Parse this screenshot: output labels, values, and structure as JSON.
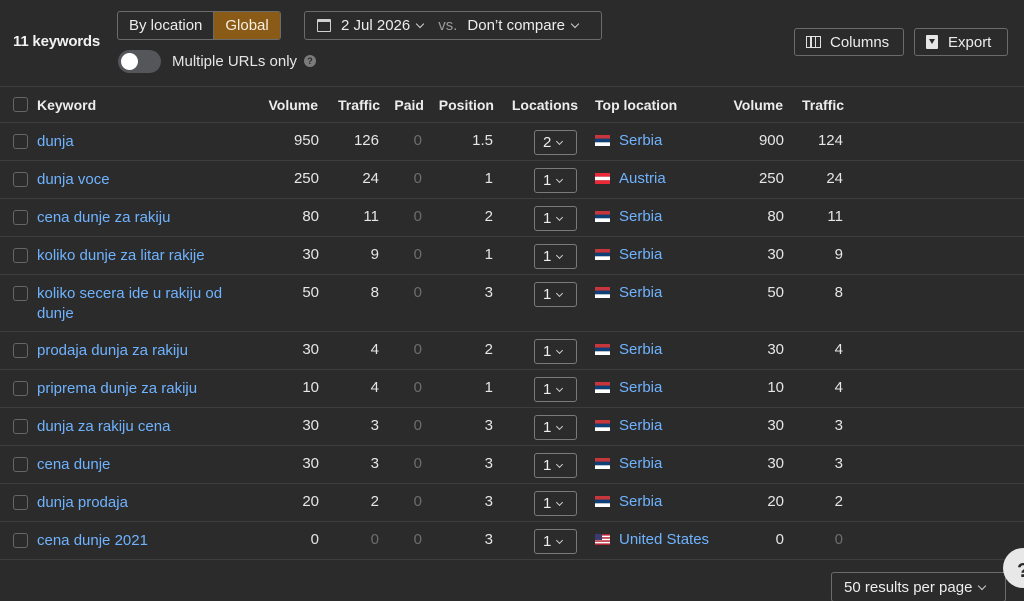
{
  "toolbar": {
    "keyword_count": "11 keywords",
    "scope_tabs": [
      "By location",
      "Global"
    ],
    "active_scope": "Global",
    "multiple_urls_label": "Multiple URLs only",
    "multiple_urls_on": false,
    "date": "2 Jul 2026",
    "vs_label": "vs.",
    "compare": "Don’t compare",
    "columns_label": "Columns",
    "export_label": "Export"
  },
  "table": {
    "headers": {
      "keyword": "Keyword",
      "volume": "Volume",
      "traffic": "Traffic",
      "paid": "Paid",
      "position": "Position",
      "locations": "Locations",
      "top_location": "Top location",
      "tl_volume": "Volume",
      "tl_traffic": "Traffic"
    },
    "rows": [
      {
        "keyword": "dunja",
        "volume": "950",
        "traffic": "126",
        "paid": "0",
        "position": "1.5",
        "locations": "2",
        "country": "Serbia",
        "flag": "serbia-flag-icon",
        "tl_volume": "900",
        "tl_traffic": "124"
      },
      {
        "keyword": "dunja voce",
        "volume": "250",
        "traffic": "24",
        "paid": "0",
        "position": "1",
        "locations": "1",
        "country": "Austria",
        "flag": "austria-flag-icon",
        "tl_volume": "250",
        "tl_traffic": "24"
      },
      {
        "keyword": "cena dunje za rakiju",
        "volume": "80",
        "traffic": "11",
        "paid": "0",
        "position": "2",
        "locations": "1",
        "country": "Serbia",
        "flag": "serbia-flag-icon",
        "tl_volume": "80",
        "tl_traffic": "11"
      },
      {
        "keyword": "koliko dunje za litar rakije",
        "volume": "30",
        "traffic": "9",
        "paid": "0",
        "position": "1",
        "locations": "1",
        "country": "Serbia",
        "flag": "serbia-flag-icon",
        "tl_volume": "30",
        "tl_traffic": "9"
      },
      {
        "keyword": "koliko secera ide u rakiju od dunje",
        "volume": "50",
        "traffic": "8",
        "paid": "0",
        "position": "3",
        "locations": "1",
        "country": "Serbia",
        "flag": "serbia-flag-icon",
        "tl_volume": "50",
        "tl_traffic": "8"
      },
      {
        "keyword": "prodaja dunja za rakiju",
        "volume": "30",
        "traffic": "4",
        "paid": "0",
        "position": "2",
        "locations": "1",
        "country": "Serbia",
        "flag": "serbia-flag-icon",
        "tl_volume": "30",
        "tl_traffic": "4"
      },
      {
        "keyword": "priprema dunje za rakiju",
        "volume": "10",
        "traffic": "4",
        "paid": "0",
        "position": "1",
        "locations": "1",
        "country": "Serbia",
        "flag": "serbia-flag-icon",
        "tl_volume": "10",
        "tl_traffic": "4"
      },
      {
        "keyword": "dunja za rakiju cena",
        "volume": "30",
        "traffic": "3",
        "paid": "0",
        "position": "3",
        "locations": "1",
        "country": "Serbia",
        "flag": "serbia-flag-icon",
        "tl_volume": "30",
        "tl_traffic": "3"
      },
      {
        "keyword": "cena dunje",
        "volume": "30",
        "traffic": "3",
        "paid": "0",
        "position": "3",
        "locations": "1",
        "country": "Serbia",
        "flag": "serbia-flag-icon",
        "tl_volume": "30",
        "tl_traffic": "3"
      },
      {
        "keyword": "dunja prodaja",
        "volume": "20",
        "traffic": "2",
        "paid": "0",
        "position": "3",
        "locations": "1",
        "country": "Serbia",
        "flag": "serbia-flag-icon",
        "tl_volume": "20",
        "tl_traffic": "2"
      },
      {
        "keyword": "cena dunje 2021",
        "volume": "0",
        "traffic": "0",
        "paid": "0",
        "position": "3",
        "locations": "1",
        "country": "United States",
        "flag": "usa-flag-icon",
        "tl_volume": "0",
        "tl_traffic": "0"
      }
    ]
  },
  "footer": {
    "per_page": "50 results per page",
    "help_fab": "?"
  },
  "colors": {
    "background": "#2b2b2c",
    "link": "#6fb3ff",
    "active_tab": "#8a5a17",
    "muted": "#6d6d6d"
  }
}
